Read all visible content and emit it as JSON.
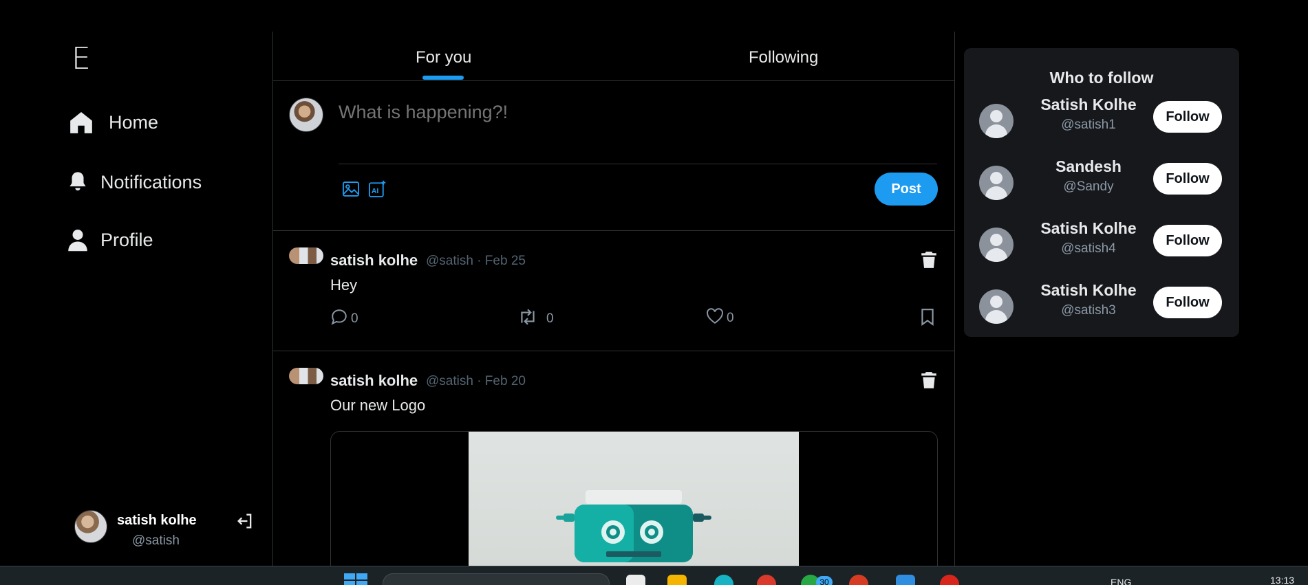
{
  "sidebar": {
    "logo": "E",
    "nav": [
      {
        "label": "Home",
        "icon": "home-icon"
      },
      {
        "label": "Notifications",
        "icon": "bell-icon"
      },
      {
        "label": "Profile",
        "icon": "user-icon"
      }
    ],
    "account": {
      "name": "satish kolhe",
      "handle": "@satish",
      "logout_icon": "logout-icon"
    }
  },
  "tabs": [
    {
      "label": "For you",
      "active": true
    },
    {
      "label": "Following",
      "active": false
    }
  ],
  "composer": {
    "placeholder": "What is happening?!",
    "post_label": "Post"
  },
  "tweets": [
    {
      "name": "satish kolhe",
      "meta": "@satish · Feb 25",
      "text": "Hey",
      "replies": "0",
      "retweets": "0",
      "likes": "0"
    },
    {
      "name": "satish kolhe",
      "meta": "@satish · Feb 20",
      "text": "Our new Logo"
    }
  ],
  "who_to_follow": {
    "title": "Who to follow",
    "follow_label": "Follow",
    "users": [
      {
        "name": "Satish Kolhe",
        "handle": "@satish1"
      },
      {
        "name": "Sandesh",
        "handle": "@Sandy"
      },
      {
        "name": "Satish Kolhe",
        "handle": "@satish4"
      },
      {
        "name": "Satish Kolhe",
        "handle": "@satish3"
      }
    ]
  },
  "taskbar": {
    "badge": "30",
    "lang": "ENG",
    "time": "13:13"
  },
  "colors": {
    "accent": "#1d9bf0",
    "background": "#000000",
    "border": "#2f3336",
    "panel": "#16181c"
  }
}
